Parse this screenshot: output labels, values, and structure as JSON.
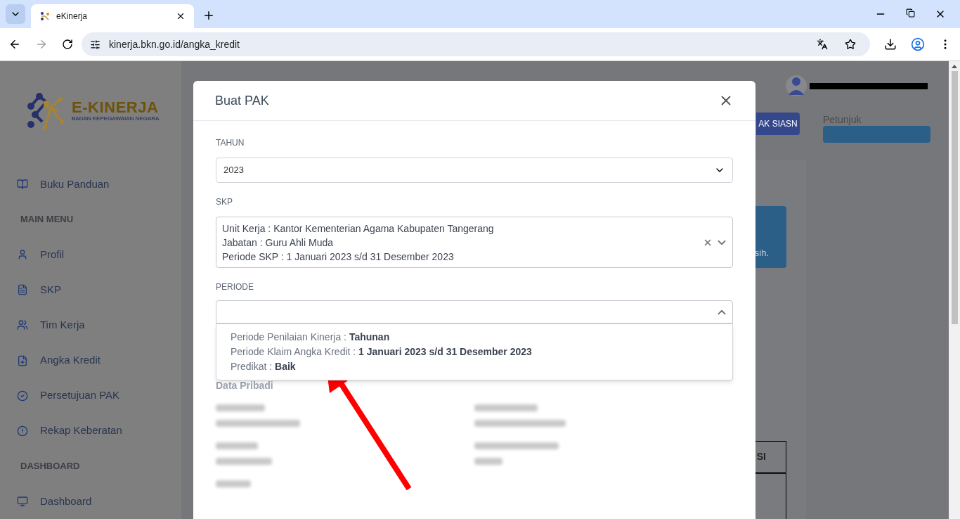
{
  "browser": {
    "tab_title": "eKinerja",
    "url": "kinerja.bkn.go.id/angka_kredit"
  },
  "sidebar": {
    "logo_title": "E-KINERJA",
    "logo_subtitle": "BADAN KEPEGAWAIAN NEGARA",
    "items": [
      {
        "kind": "link",
        "label": "Buku Panduan"
      },
      {
        "kind": "heading",
        "label": "MAIN MENU"
      },
      {
        "kind": "link",
        "label": "Profil"
      },
      {
        "kind": "link",
        "label": "SKP"
      },
      {
        "kind": "link",
        "label": "Tim Kerja"
      },
      {
        "kind": "link",
        "label": "Angka Kredit"
      },
      {
        "kind": "link",
        "label": "Persetujuan PAK"
      },
      {
        "kind": "link",
        "label": "Rekap Keberatan"
      },
      {
        "kind": "heading",
        "label": "DASHBOARD"
      },
      {
        "kind": "link",
        "label": "Dashboard"
      }
    ]
  },
  "background": {
    "siasn_button": "AK SIASN",
    "petunjuk_label": "Petunjuk",
    "notice_fragment": "sih.",
    "table_fragment": "SI"
  },
  "modal": {
    "title": "Buat PAK",
    "tahun": {
      "label": "TAHUN",
      "value": "2023"
    },
    "skp": {
      "label": "SKP",
      "lines": [
        "Unit Kerja : Kantor Kementerian Agama Kabupaten Tangerang",
        "Jabatan : Guru Ahli Muda",
        "Periode SKP : 1 Januari 2023 s/d 31 Desember 2023"
      ]
    },
    "periode": {
      "label": "PERIODE",
      "expanded": true,
      "option_lines": [
        "Periode Penilaian Kinerja : **Tahunan**",
        "Periode Klaim Angka Kredit : **1 Januari 2023 s/d 31 Desember 2023**",
        "Predikat : **Baik**"
      ]
    },
    "section_title": "Data Pribadi"
  }
}
